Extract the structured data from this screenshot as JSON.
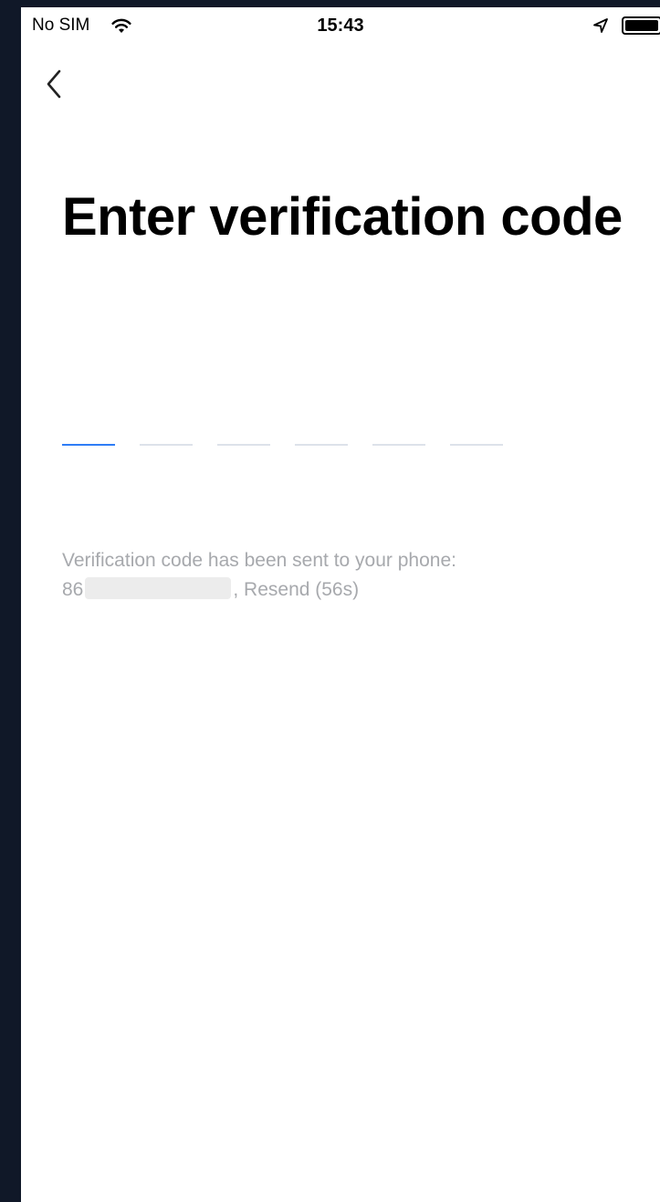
{
  "status_bar": {
    "carrier": "No SIM",
    "time": "15:43",
    "icons": [
      "wifi-icon",
      "location-icon",
      "battery-icon"
    ]
  },
  "nav": {
    "back_icon": "chevron-left-icon"
  },
  "page": {
    "title": "Enter verification code"
  },
  "code_input": {
    "slots": [
      "",
      "",
      "",
      "",
      "",
      ""
    ],
    "active_index": 0,
    "active_color": "#2f7df6",
    "inactive_color": "#dde2ea"
  },
  "notice": {
    "text": "Verification code has been sent to your phone:",
    "phone_prefix": "86",
    "separator": ",",
    "resend_label": "Resend (56s)",
    "text_color": "#a7a9ad"
  }
}
